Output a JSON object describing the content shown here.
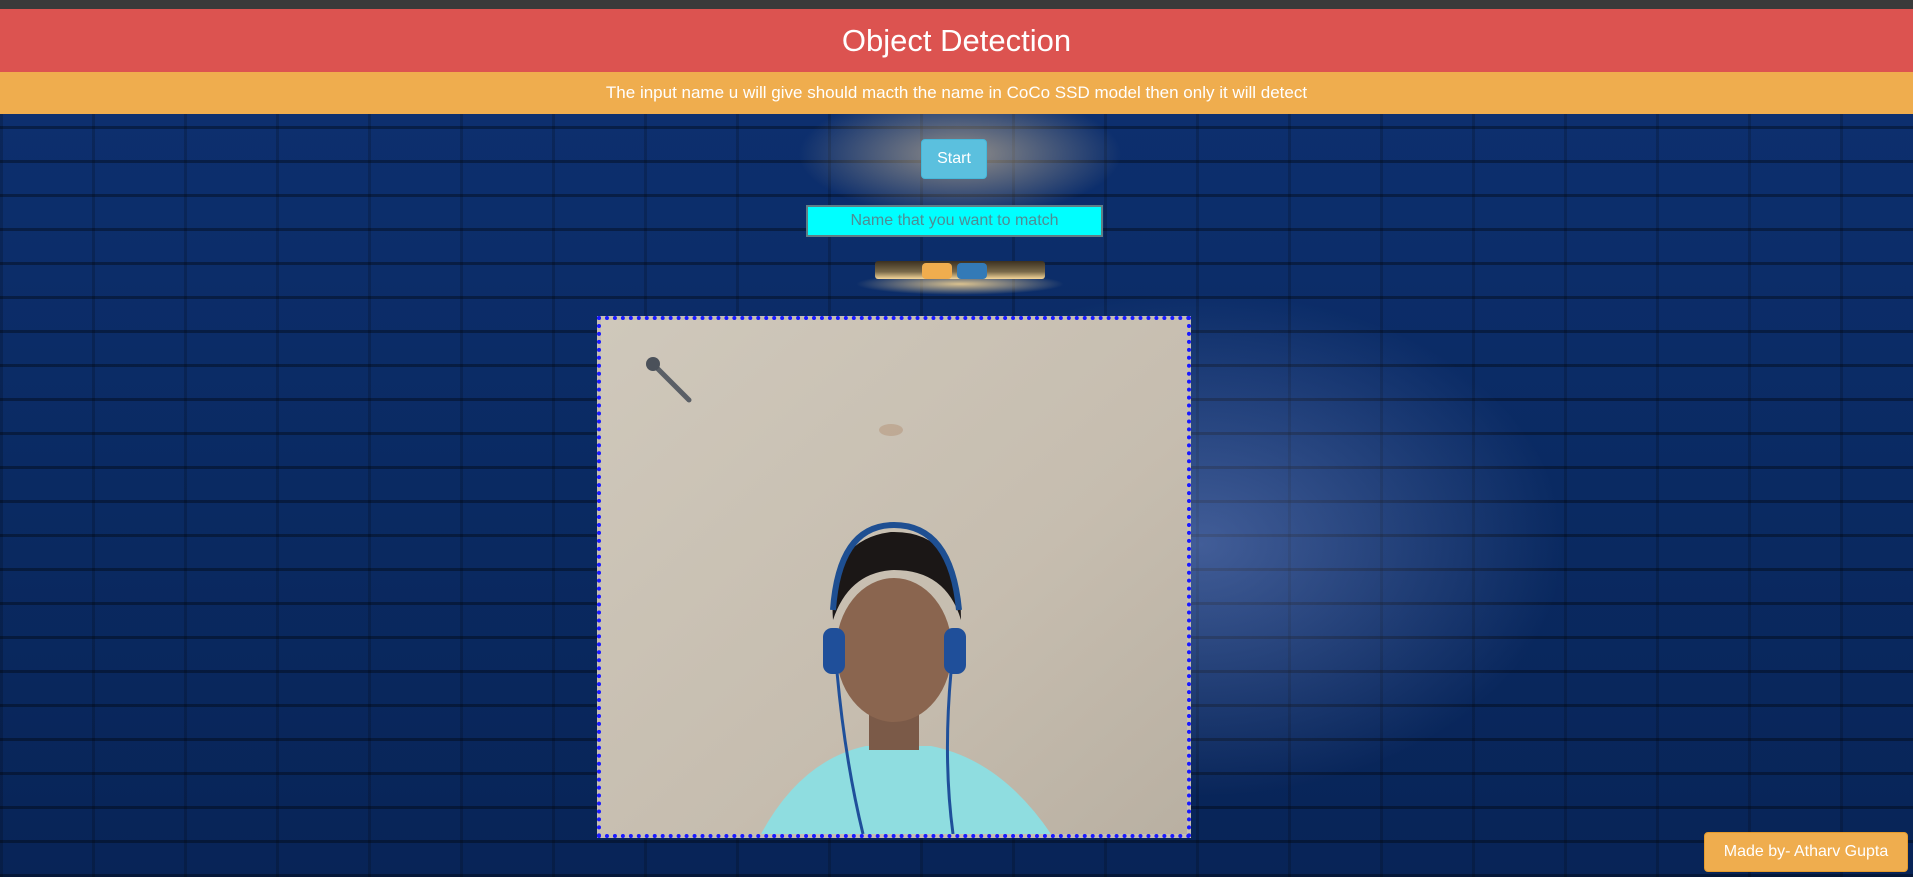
{
  "header": {
    "title": "Object Detection"
  },
  "info_bar": {
    "text": "The input name u will give should macth the name in CoCo SSD model then only it will detect"
  },
  "controls": {
    "start_label": "Start",
    "name_input": {
      "value": "",
      "placeholder": "Name that you want to match"
    }
  },
  "footer": {
    "credit": "Made by- Atharv Gupta"
  },
  "colors": {
    "header_bg": "#dc5350",
    "info_bg": "#efad4e",
    "start_bg": "#5bc0de",
    "input_bg": "#00ffff",
    "frame_border": "#1919ff",
    "wall": "#0b2a63"
  }
}
